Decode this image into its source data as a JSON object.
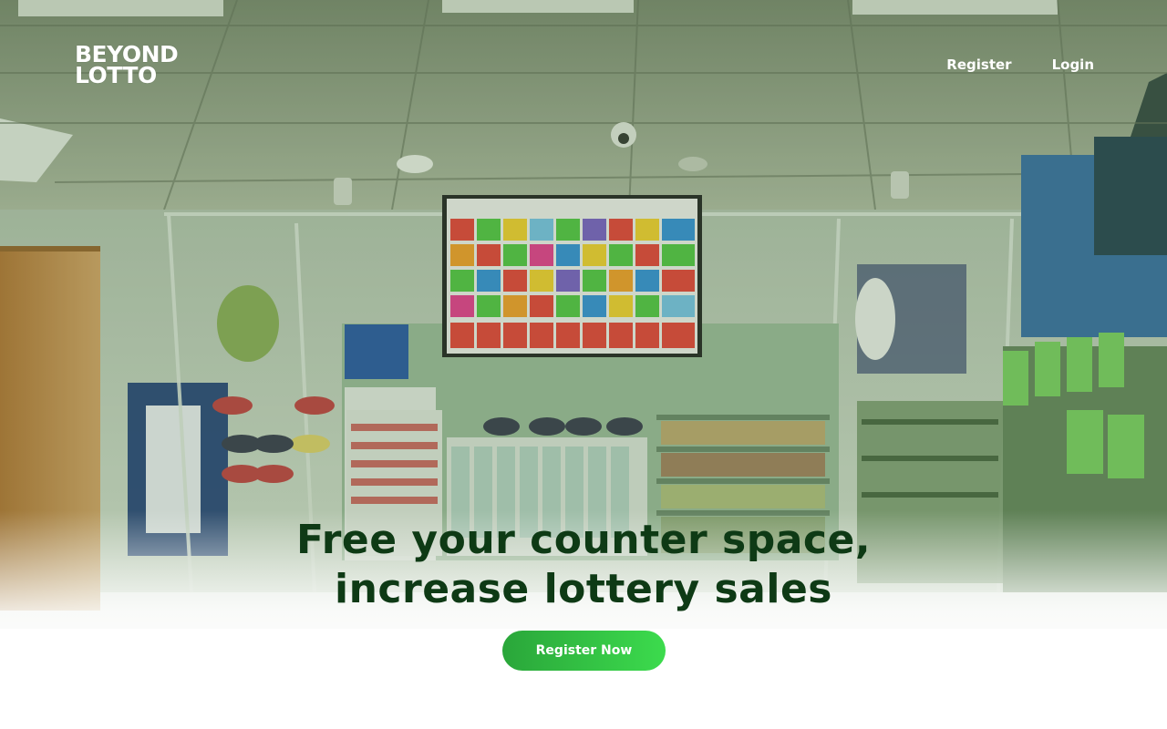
{
  "brand": {
    "logo_line1": "BEYOND",
    "logo_line2": "LOTTO"
  },
  "nav": {
    "register_label": "Register",
    "login_label": "Login"
  },
  "hero": {
    "title": "Free your counter space, increase lottery sales",
    "cta_label": "Register Now",
    "background": "store-interior-photo"
  },
  "colors": {
    "title": "#0e3a15",
    "cta_start": "#2aa63a",
    "cta_end": "#3cdb4d",
    "nav_text": "#ffffff"
  }
}
